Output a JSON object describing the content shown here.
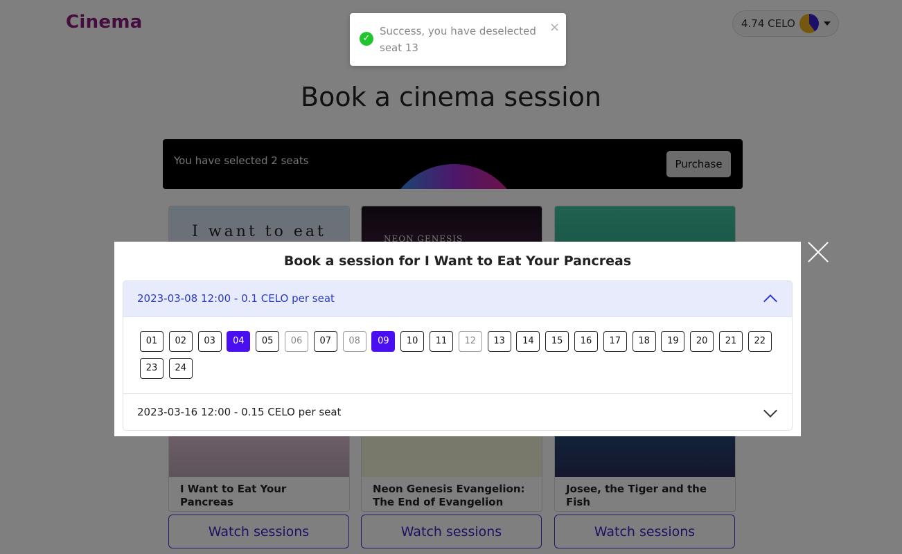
{
  "navbar": {
    "brand": "Cinema",
    "wallet_balance": "4.74 CELO"
  },
  "page": {
    "title": "Book a cinema session"
  },
  "selection": {
    "text": "You have selected 2 seats",
    "purchase_label": "Purchase"
  },
  "movies": [
    {
      "title": "I Want to Eat Your Pancreas",
      "poster_text": "I want to eat",
      "button": "Watch sessions"
    },
    {
      "title": "Neon Genesis Evangelion: The End of Evangelion",
      "poster_text": "NEON GENESIS",
      "button": "Watch sessions"
    },
    {
      "title": "Josee, the Tiger and the Fish",
      "poster_text": "",
      "button": "Watch sessions"
    }
  ],
  "toast": {
    "message": "Success, you have deselected seat 13",
    "close": "×"
  },
  "modal": {
    "title": "Book a session for I Want to Eat Your Pancreas",
    "sessions": [
      {
        "label": "2023-03-08 12:00 - 0.1 CELO per seat",
        "expanded": true
      },
      {
        "label": "2023-03-16 12:00 - 0.15 CELO per seat",
        "expanded": false
      }
    ],
    "seats": [
      "01",
      "02",
      "03",
      "04",
      "05",
      "06",
      "07",
      "08",
      "09",
      "10",
      "11",
      "12",
      "13",
      "14",
      "15",
      "16",
      "17",
      "18",
      "19",
      "20",
      "21",
      "22",
      "23",
      "24"
    ],
    "selected_seats": [
      "04",
      "09"
    ],
    "taken_seats": [
      "06",
      "08",
      "12"
    ]
  },
  "colors": {
    "brand": "#8a1a7a",
    "accent": "#4a0ff0",
    "success": "#22c52e"
  }
}
